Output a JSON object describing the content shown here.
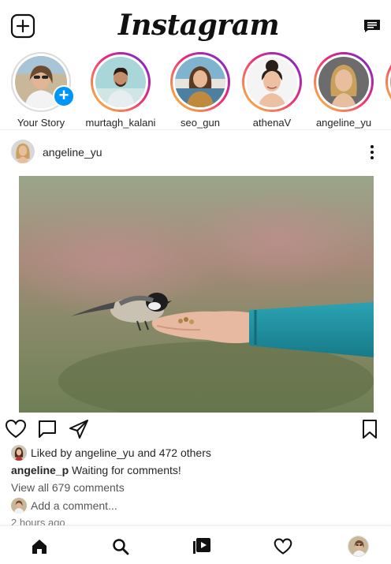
{
  "header": {
    "logo": "Instagram"
  },
  "stories": [
    {
      "label": "Your Story",
      "own": true
    },
    {
      "label": "murtagh_kalani"
    },
    {
      "label": "seo_gun"
    },
    {
      "label": "athenaV"
    },
    {
      "label": "angeline_yu"
    }
  ],
  "post": {
    "username": "angeline_yu",
    "liked_prefix": "Liked by ",
    "liked_user": "angeline_yu",
    "liked_suffix": " and 472 others",
    "caption_user": "angeline_p",
    "caption_text": "Waiting for comments!",
    "view_all": "View all 679 comments",
    "add_comment": "Add a comment...",
    "time": "2 hours ago"
  },
  "colors": {
    "story_ring_start": "#f9ce34",
    "story_ring_mid": "#ee2a7b",
    "story_ring_end": "#6228d7",
    "own_story_plus": "#0095f6",
    "sleeve": "#1f8fa0"
  },
  "icons": {
    "new_post": "plus-square-icon",
    "direct": "message-icon",
    "more": "more-vertical-icon",
    "like": "heart-icon",
    "comment": "comment-icon",
    "share": "send-icon",
    "save": "bookmark-icon",
    "nav_home": "home-icon",
    "nav_search": "search-icon",
    "nav_reels": "reels-icon",
    "nav_activity": "heart-icon"
  }
}
